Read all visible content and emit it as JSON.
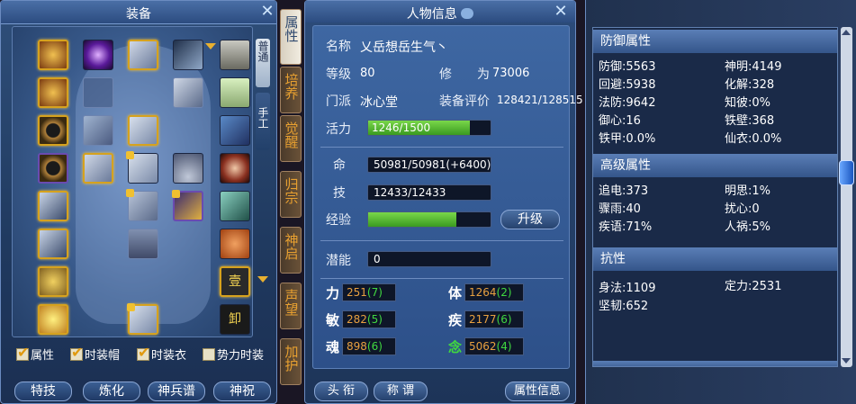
{
  "equip": {
    "title": "装备",
    "tabs": [
      "普通",
      "手工"
    ],
    "checkboxes": [
      {
        "label": "属性",
        "checked": true
      },
      {
        "label": "时装帽",
        "checked": true
      },
      {
        "label": "时装衣",
        "checked": true
      },
      {
        "label": "势力时装",
        "checked": false
      }
    ],
    "buttons": [
      "特技",
      "炼化",
      "神兵谱",
      "神祝"
    ],
    "slot_glyph_ding": "壹",
    "slot_glyph_xie": "卸"
  },
  "vtabs": [
    "属性",
    "培养",
    "觉醒",
    "归宗",
    "神启",
    "声望",
    "加护"
  ],
  "char": {
    "title": "人物信息",
    "name_label": "名称",
    "name_value": "乂岳想岳生气丶",
    "level_label": "等级",
    "level_value": "80",
    "cult_label": "修　　为",
    "cult_value": "73006",
    "sect_label": "门派",
    "sect_value": "冰心堂",
    "rating_label": "装备评价",
    "rating_value": "128421/128515",
    "vitality_label": "活力",
    "vitality_value": "1246/1500",
    "vitality_fraction": 0.831,
    "life_label": "命",
    "life_value": "50981/50981(+6400)",
    "skill_label": "技",
    "skill_value": "12433/12433",
    "exp_label": "经验",
    "exp_fraction": 0.72,
    "upgrade_label": "升级",
    "potential_label": "潜能",
    "potential_value": "0",
    "stats": [
      {
        "label": "力",
        "value": "251",
        "bonus": "(7)"
      },
      {
        "label": "体",
        "value": "1264",
        "bonus": "(2)"
      },
      {
        "label": "敏",
        "value": "282",
        "bonus": "(5)"
      },
      {
        "label": "疾",
        "value": "2177",
        "bonus": "(6)"
      },
      {
        "label": "魂",
        "value": "898",
        "bonus": "(6)"
      },
      {
        "label": "念",
        "value": "5062",
        "bonus": "(4)"
      }
    ],
    "btn_title": "头 衔",
    "btn_call": "称 谓",
    "btn_info": "属性信息"
  },
  "attrs": {
    "defense_title": "防御属性",
    "defense": [
      [
        "防御:5563",
        "神明:4149"
      ],
      [
        "回避:5938",
        "化解:328"
      ],
      [
        "法防:9642",
        "知彼:0%"
      ],
      [
        "御心:16",
        "铁壁:368"
      ],
      [
        "铁甲:0.0%",
        "仙衣:0.0%"
      ]
    ],
    "advanced_title": "高级属性",
    "advanced": [
      [
        "追电:373",
        "明思:1%"
      ],
      [
        "骤雨:40",
        "扰心:0"
      ],
      [
        "疾语:71%",
        "人祸:5%"
      ]
    ],
    "resist_title": "抗性",
    "resist": [
      [
        "身法:1109",
        "定力:2531"
      ],
      [
        "坚韧:652",
        ""
      ]
    ]
  }
}
